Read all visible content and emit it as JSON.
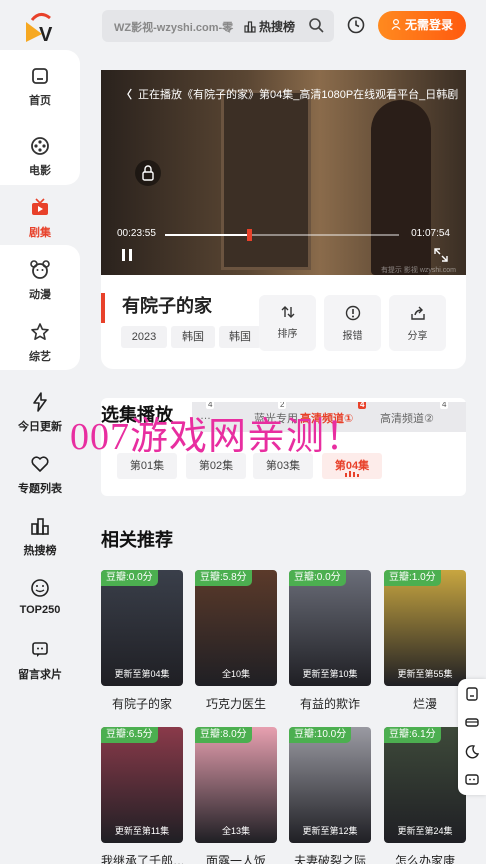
{
  "header": {
    "search_placeholder": "WZ影视-wzyshi.com-零",
    "hot_label": "热搜榜",
    "login_label": "无需登录"
  },
  "sidebar": {
    "items": [
      {
        "label": "首页",
        "icon": "home-icon"
      },
      {
        "label": "电影",
        "icon": "film-reel-icon"
      },
      {
        "label": "剧集",
        "icon": "tv-icon",
        "active": true
      },
      {
        "label": "动漫",
        "icon": "bear-icon"
      },
      {
        "label": "综艺",
        "icon": "star-icon"
      },
      {
        "label": "今日更新",
        "icon": "lightning-icon"
      },
      {
        "label": "专题列表",
        "icon": "heart-icon"
      },
      {
        "label": "热搜榜",
        "icon": "chart-icon"
      },
      {
        "label": "TOP250",
        "icon": "smile-icon"
      },
      {
        "label": "留言求片",
        "icon": "message-icon"
      }
    ]
  },
  "player": {
    "title": "正在播放《有院子的家》第04集_高清1080P在线观看平台_日韩剧",
    "current_time": "00:23:55",
    "duration": "01:07:54",
    "progress": 0.352,
    "watermark": "有提示 影视 wzyshi.com"
  },
  "info": {
    "name": "有院子的家",
    "tags": [
      "2023",
      "韩国",
      "韩国"
    ],
    "actions": [
      {
        "label": "排序",
        "icon": "sort-icon"
      },
      {
        "label": "报错",
        "icon": "alert-icon"
      },
      {
        "label": "分享",
        "icon": "share-icon"
      }
    ]
  },
  "episodes": {
    "title": "选集播放",
    "sources": [
      {
        "label": "…",
        "count": "4"
      },
      {
        "label": "蓝光专用",
        "count": "2"
      },
      {
        "label": "高清频道①",
        "count": "4",
        "active": true
      },
      {
        "label": "高清频道②",
        "count": "4"
      }
    ],
    "list": [
      "第01集",
      "第02集",
      "第03集",
      "第04集"
    ],
    "active_index": 3
  },
  "overlay_text": "007游戏网亲测！",
  "recommend": {
    "title": "相关推荐",
    "items": [
      {
        "rating": "豆瓣:0.0分",
        "update": "更新至第04集",
        "title": "有院子的家",
        "color": "#3a3f4a"
      },
      {
        "rating": "豆瓣:5.8分",
        "update": "全10集",
        "title": "巧克力医生",
        "color": "#5b3a2a"
      },
      {
        "rating": "豆瓣:0.0分",
        "update": "更新至第10集",
        "title": "有益的欺诈",
        "color": "#6a6d78"
      },
      {
        "rating": "豆瓣:1.0分",
        "update": "更新至第55集",
        "title": "烂漫",
        "color": "#c8a640"
      },
      {
        "rating": "豆瓣:6.5分",
        "update": "更新至第11集",
        "title": "我继承了千郎…",
        "color": "#8a3a4a"
      },
      {
        "rating": "豆瓣:8.0分",
        "update": "全13集",
        "title": "面露一人饭",
        "color": "#e7a0b0"
      },
      {
        "rating": "豆瓣:10.0分",
        "update": "更新至第12集",
        "title": "夫妻破裂之际",
        "color": "#9a9aa2"
      },
      {
        "rating": "豆瓣:6.1分",
        "update": "更新至第24集",
        "title": "怎么办家康",
        "color": "#3e4a3a"
      }
    ]
  },
  "tools": [
    "document-icon",
    "car-icon",
    "moon-icon",
    "message-icon"
  ]
}
